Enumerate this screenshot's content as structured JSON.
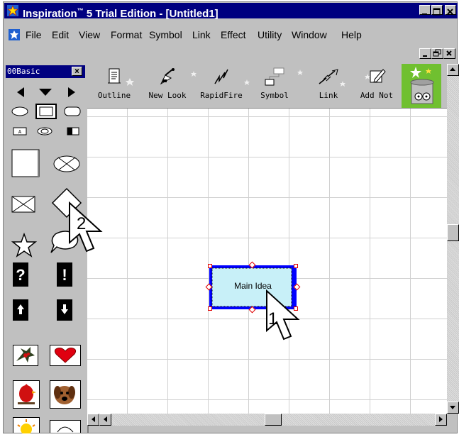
{
  "window": {
    "title": "Inspiration™ 5 Trial Edition - [Untitled1]",
    "title_main": "Inspiration",
    "title_mark": "™",
    "title_rest": " 5 Trial Edition - [Untitled1]"
  },
  "menu": {
    "items": [
      "File",
      "Edit",
      "View",
      "Format",
      "Symbol",
      "Link",
      "Effect",
      "Utility",
      "Window",
      "Help"
    ]
  },
  "palette": {
    "title": "00Basic",
    "close_label": "×"
  },
  "toolbar": {
    "items": [
      {
        "label": "Outline",
        "icon": "outline-icon"
      },
      {
        "label": "New Look",
        "icon": "new-look-icon"
      },
      {
        "label": "RapidFire",
        "icon": "rapidfire-icon"
      },
      {
        "label": "Symbol",
        "icon": "symbol-icon"
      },
      {
        "label": "Link",
        "icon": "link-icon"
      },
      {
        "label": "Add Not",
        "icon": "add-note-icon"
      }
    ]
  },
  "canvas": {
    "node_label": "Main Idea"
  },
  "annotations": {
    "cursor1": "1",
    "cursor2": "2"
  },
  "colors": {
    "titlebar": "#000080",
    "node_fill": "#c8f0f8",
    "node_border": "#0000ff",
    "handle": "#e00000",
    "heart": "#e00010"
  }
}
